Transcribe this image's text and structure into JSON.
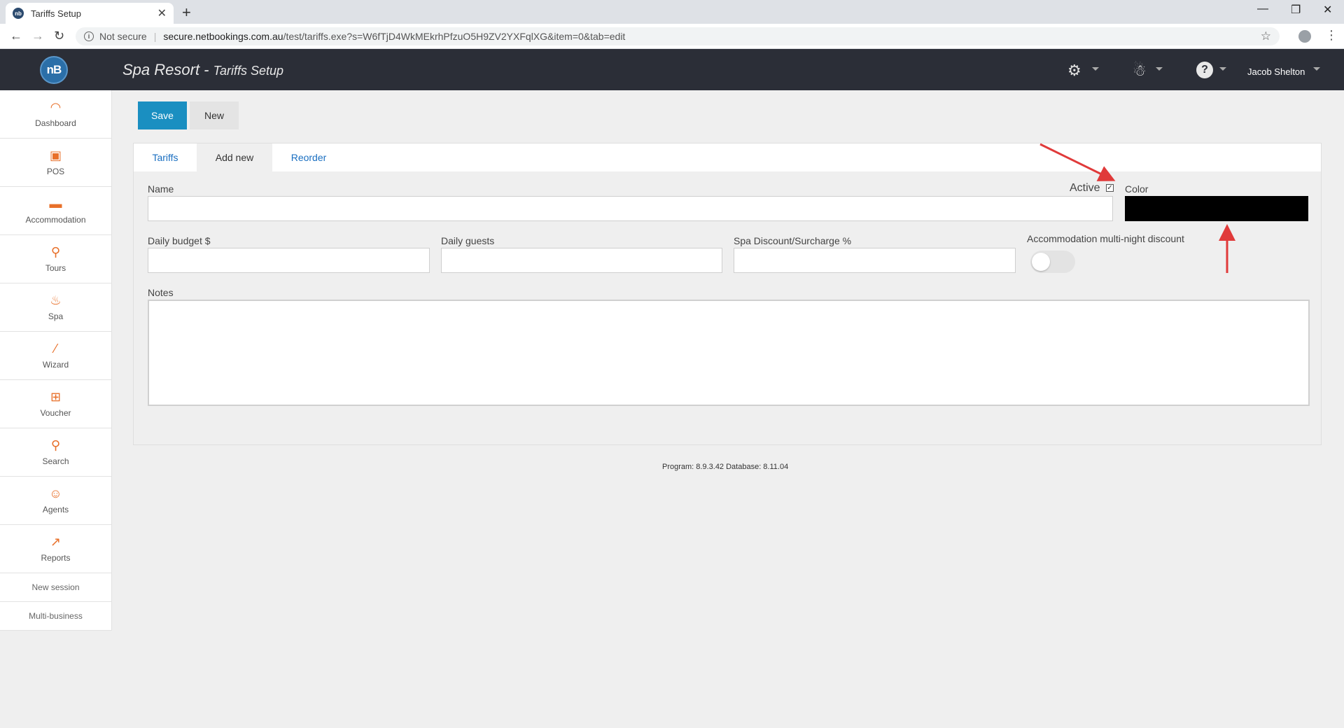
{
  "browser": {
    "tab_title": "Tariffs Setup",
    "favicon_text": "nb",
    "security_label": "Not secure",
    "url_host": "secure.netbookings.com.au",
    "url_path": "/test/tariffs.exe?s=W6fTjD4WkMEkrhPfzuO5H9ZV2YXFqlXG&item=0&tab=edit"
  },
  "header": {
    "logo_text": "nB",
    "title_main": "Spa Resort - ",
    "title_sub": "Tariffs Setup",
    "user_name": "Jacob Shelton"
  },
  "sidebar": {
    "items": [
      {
        "label": "Dashboard",
        "icon": "gauge-icon"
      },
      {
        "label": "POS",
        "icon": "pos-terminal-icon"
      },
      {
        "label": "Accommodation",
        "icon": "bed-icon"
      },
      {
        "label": "Tours",
        "icon": "tour-icon"
      },
      {
        "label": "Spa",
        "icon": "spa-icon"
      },
      {
        "label": "Wizard",
        "icon": "magic-wand-icon"
      },
      {
        "label": "Voucher",
        "icon": "gift-icon"
      },
      {
        "label": "Search",
        "icon": "search-icon"
      },
      {
        "label": "Agents",
        "icon": "agent-icon"
      },
      {
        "label": "Reports",
        "icon": "chart-icon"
      }
    ],
    "links": [
      "New session",
      "Multi-business"
    ]
  },
  "toolbar": {
    "save_label": "Save",
    "new_label": "New"
  },
  "tabs": [
    {
      "label": "Tariffs",
      "active": false
    },
    {
      "label": "Add new",
      "active": true
    },
    {
      "label": "Reorder",
      "active": false
    }
  ],
  "form": {
    "name_label": "Name",
    "active_label": "Active",
    "active_checked": true,
    "color_label": "Color",
    "color_value": "#000000",
    "daily_budget_label": "Daily budget $",
    "daily_guests_label": "Daily guests",
    "spa_discount_label": "Spa Discount/Surcharge %",
    "multi_night_label": "Accommodation multi-night discount",
    "multi_night_on": false,
    "notes_label": "Notes"
  },
  "footer": {
    "version": "Program: 8.9.3.42 Database: 8.11.04"
  },
  "colors": {
    "accent": "#1a8fc1",
    "header_bg": "#2b2e37",
    "sidebar_icon": "#e8702a",
    "annotation_arrow": "#e03a3a"
  }
}
